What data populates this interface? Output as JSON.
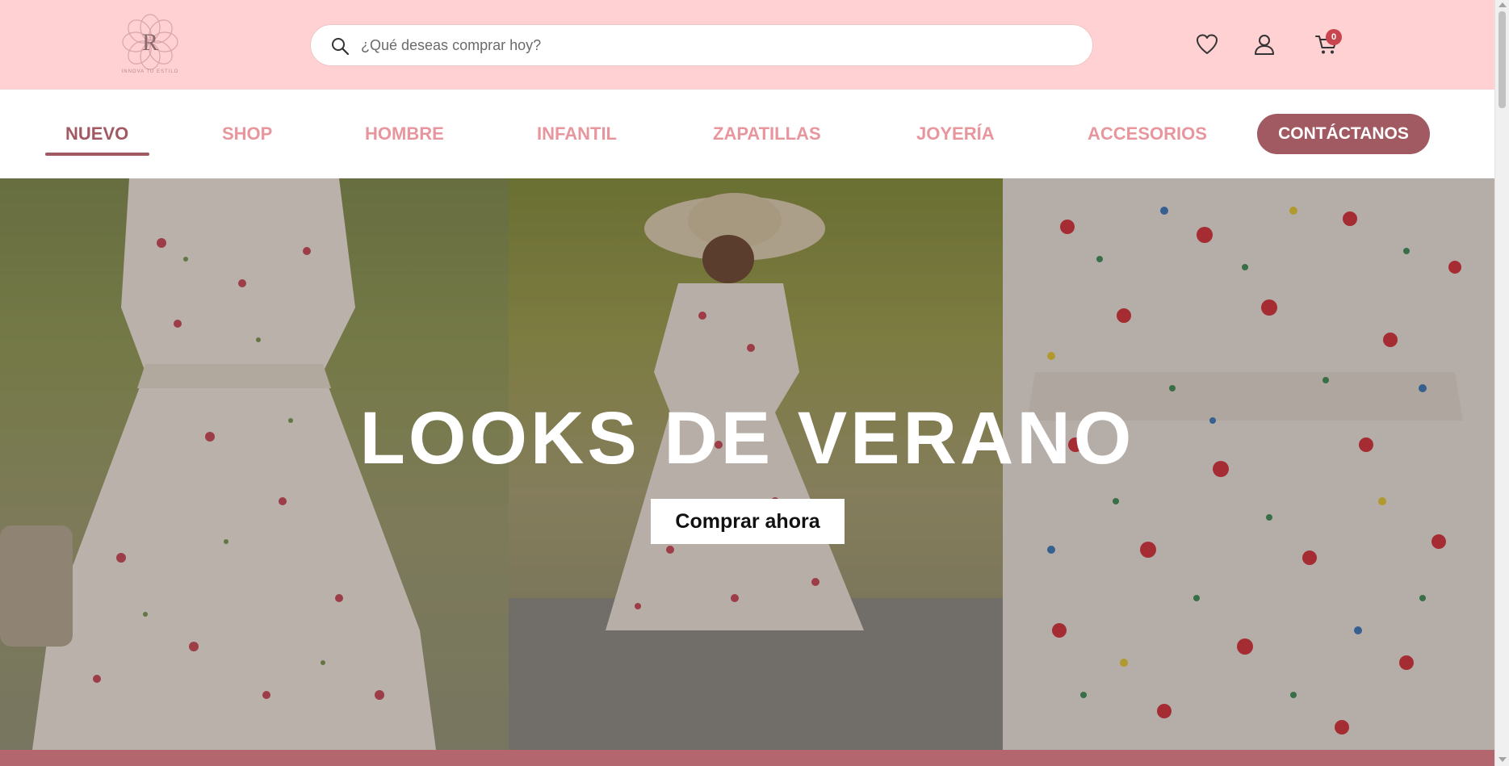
{
  "header": {
    "logo_letter": "R",
    "logo_tagline": "INNOVA TU ESTILO",
    "search": {
      "placeholder": "¿Qué deseas comprar hoy?",
      "value": ""
    },
    "icons": [
      "search-icon",
      "heart-icon",
      "user-icon",
      "cart-icon"
    ],
    "cart_count": "0"
  },
  "nav": {
    "items": [
      {
        "label": "NUEVO",
        "active": true
      },
      {
        "label": "SHOP",
        "active": false
      },
      {
        "label": "HOMBRE",
        "active": false
      },
      {
        "label": "INFANTIL",
        "active": false
      },
      {
        "label": "ZAPATILLAS",
        "active": false
      },
      {
        "label": "JOYERÍA",
        "active": false
      },
      {
        "label": "ACCESORIOS",
        "active": false
      }
    ],
    "contact_label": "CONTÁCTANOS"
  },
  "hero": {
    "title": "LOOKS DE VERANO",
    "button_label": "Comprar ahora"
  },
  "colors": {
    "header_bg": "#ffd1d3",
    "accent": "#a15a62",
    "nav_text": "#e8969d",
    "badge": "#c8454f",
    "bottom_strip": "#b3666d"
  }
}
